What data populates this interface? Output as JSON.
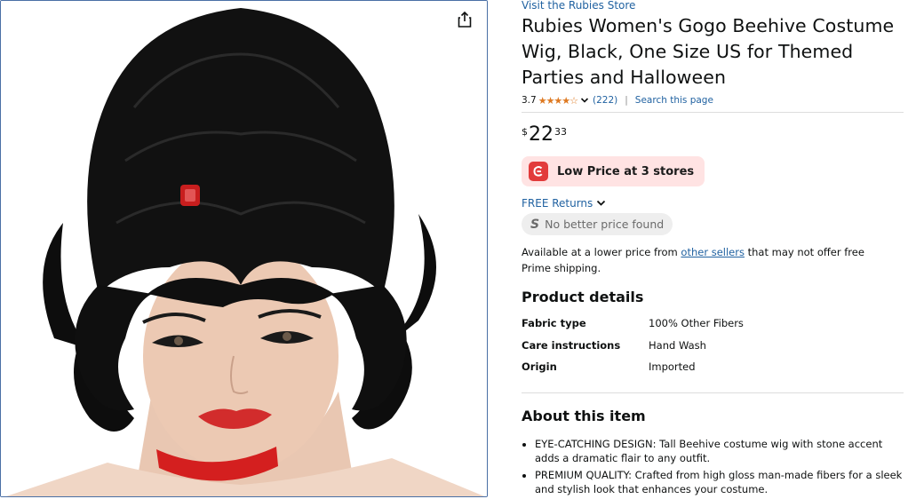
{
  "product": {
    "store_link": "Visit the Rubies Store",
    "title": "Rubies Women's Gogo Beehive Costume Wig, Black, One Size US for Themed Parties and Halloween",
    "rating_value": "3.7",
    "rating_stars": 3.7,
    "stars_display": "★★★★☆",
    "review_count": "(222)",
    "search_page": "Search this page",
    "separator": "|",
    "price": {
      "symbol": "$",
      "whole": "22",
      "fraction": "33"
    },
    "low_price_label": "Low Price at 3 stores",
    "free_returns": "FREE Returns",
    "no_better_letter": "S",
    "no_better_price": "No better price found",
    "avail_before": "Available at a lower price from ",
    "avail_link": "other sellers",
    "avail_after": " that may not offer free Prime shipping."
  },
  "details": {
    "heading": "Product details",
    "rows": [
      {
        "key": "Fabric type",
        "value": "100% Other Fibers"
      },
      {
        "key": "Care instructions",
        "value": "Hand Wash"
      },
      {
        "key": "Origin",
        "value": "Imported"
      }
    ]
  },
  "about": {
    "heading": "About this item",
    "bullets": [
      "EYE-CATCHING DESIGN: Tall Beehive costume wig with stone accent adds a dramatic flair to any outfit.",
      "PREMIUM QUALITY: Crafted from high gloss man-made fibers for a sleek and stylish look that enhances your costume."
    ]
  },
  "colors": {
    "link": "#2162a1",
    "star": "#de7921",
    "low_price_bg": "#ffe3e3",
    "low_price_logo": "#e23b3b",
    "image_border": "#4a6fa5"
  },
  "icons": {
    "share": "share-icon",
    "chevron": "chevron-down-icon",
    "coupon_logo": "coupon-logo-icon"
  }
}
